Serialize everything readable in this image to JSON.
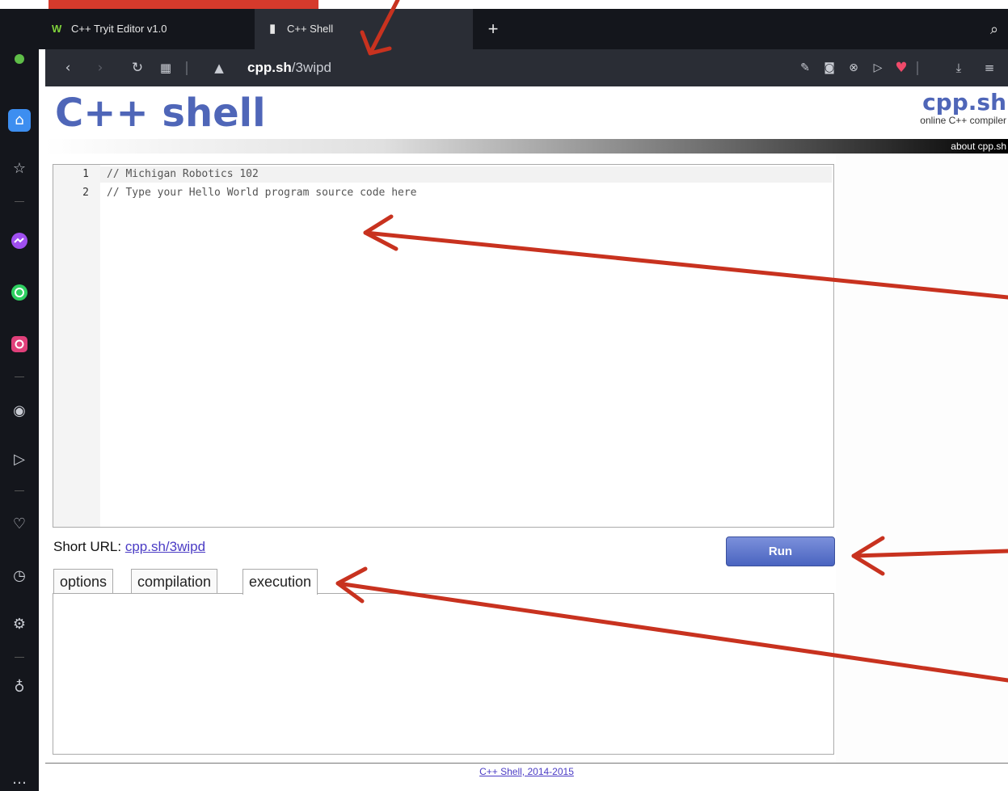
{
  "browser": {
    "tabs": [
      {
        "label": "C++ Tryit Editor v1.0",
        "icon": "w-logo-icon"
      },
      {
        "label": "C++ Shell",
        "icon": "document-icon"
      }
    ],
    "new_tab_label": "+",
    "url_host": "cpp.sh",
    "url_path": "/3wipd"
  },
  "page": {
    "logo": "C++ shell",
    "brand_name": "cpp.sh",
    "brand_tagline": "online C++ compiler",
    "about_link": "about cpp.sh",
    "editor": {
      "lines": [
        {
          "number": "1",
          "text": "// Michigan Robotics 102"
        },
        {
          "number": "2",
          "text": "// Type your Hello World program source code here"
        }
      ]
    },
    "short_url_label": "Short URL:",
    "short_url_value": "cpp.sh/3wipd",
    "run_label": "Run",
    "panel_tabs": [
      "options",
      "compilation",
      "execution"
    ],
    "active_panel_tab": "execution",
    "footer": "C++ Shell, 2014-2015"
  },
  "colors": {
    "annotation_red": "#c8321f",
    "brand_blue": "#4f66b8",
    "link_purple": "#4b3cc5"
  }
}
